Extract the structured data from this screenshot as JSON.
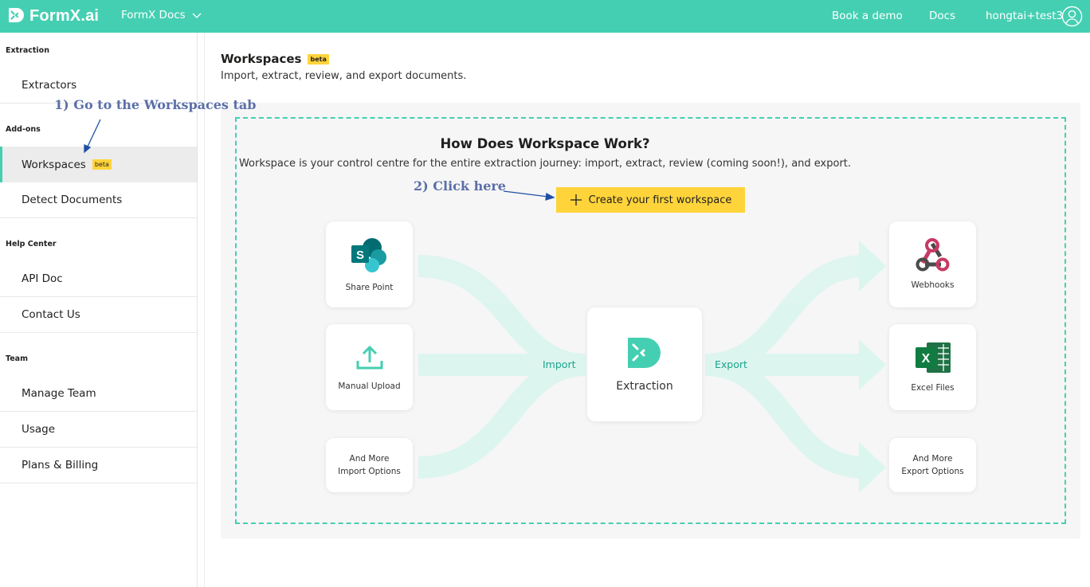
{
  "header": {
    "brand": "FormX.ai",
    "docs_menu": "FormX Docs",
    "links": [
      "Book a demo",
      "Docs",
      "hongtai+test3"
    ]
  },
  "sidebar": {
    "sections": [
      {
        "title": "Extraction",
        "items": [
          "Extractors"
        ]
      },
      {
        "title": "Add-ons",
        "items": [
          "Workspaces",
          "Detect Documents"
        ]
      },
      {
        "title": "Help Center",
        "items": [
          "API Doc",
          "Contact Us"
        ]
      },
      {
        "title": "Team",
        "items": [
          "Manage Team",
          "Usage",
          "Plans & Billing"
        ]
      }
    ],
    "active_item": "Workspaces",
    "beta_badge": "beta"
  },
  "main": {
    "title": "Workspaces",
    "beta_badge": "beta",
    "subtitle": "Import, extract, review, and export documents.",
    "how": {
      "title": "How Does Workspace Work?",
      "subtitle": "Workspace is your control centre for the entire extraction journey: import, extract, review (coming soon!), and export.",
      "create_button": "Create your first workspace"
    },
    "sources": [
      "Share Point",
      "Manual Upload",
      "And More\nImport Options"
    ],
    "center": "Extraction",
    "import_label": "Import",
    "export_label": "Export",
    "destinations": [
      "Webhooks",
      "Excel Files",
      "And More\nExport Options"
    ]
  },
  "annotations": {
    "step1": "1) Go to the Workspaces tab",
    "step2": "2) Click here"
  },
  "colors": {
    "brand": "#45cfb2",
    "badge": "#ffd43b",
    "annotation": "#5b6fa8",
    "flow": "#d9f5ee"
  }
}
